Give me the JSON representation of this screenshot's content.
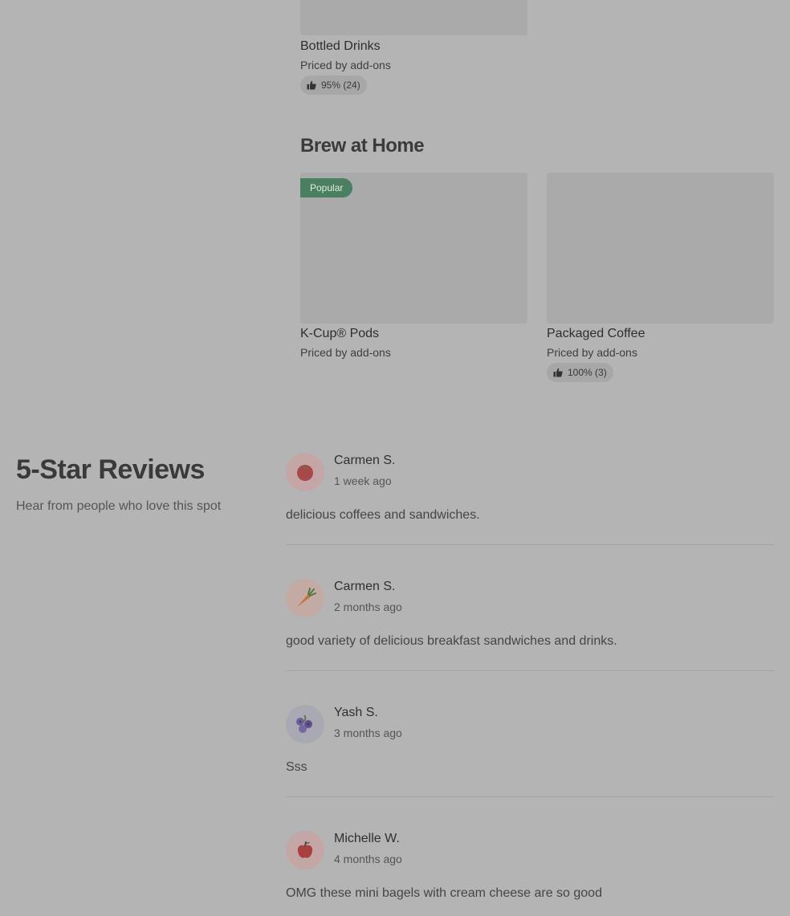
{
  "menu": {
    "bottled_drinks": {
      "name": "Bottled Drinks",
      "price": "Priced by add-ons",
      "rating": "95% (24)"
    },
    "brew_at_home": {
      "title": "Brew at Home",
      "items": [
        {
          "name": "K-Cup® Pods",
          "price": "Priced by add-ons",
          "badge": "Popular"
        },
        {
          "name": "Packaged Coffee",
          "price": "Priced by add-ons",
          "rating": "100% (3)"
        }
      ]
    }
  },
  "reviews": {
    "title": "5-Star Reviews",
    "subtitle": "Hear from people who love this spot",
    "items": [
      {
        "name": "Carmen S.",
        "date": "1 week ago",
        "text": "delicious coffees and sandwiches.",
        "avatar_icon": "tomato-icon",
        "avatar_bg": "#c4a6a6"
      },
      {
        "name": "Carmen S.",
        "date": "2 months ago",
        "text": "good variety of delicious breakfast sandwiches and drinks.",
        "avatar_icon": "carrot-icon",
        "avatar_bg": "#c4aaa4"
      },
      {
        "name": "Yash S.",
        "date": "3 months ago",
        "text": "Sss",
        "avatar_icon": "blueberry-icon",
        "avatar_bg": "#a9a9b3"
      },
      {
        "name": "Michelle W.",
        "date": "4 months ago",
        "text": "OMG these mini bagels with cream cheese are so good",
        "avatar_icon": "apple-icon",
        "avatar_bg": "#c4a6a6"
      }
    ]
  },
  "colors": {
    "page_bg": "#b4b4b4",
    "popular_badge": "#4a7f61",
    "image_placeholder": "#aaaaaa"
  }
}
